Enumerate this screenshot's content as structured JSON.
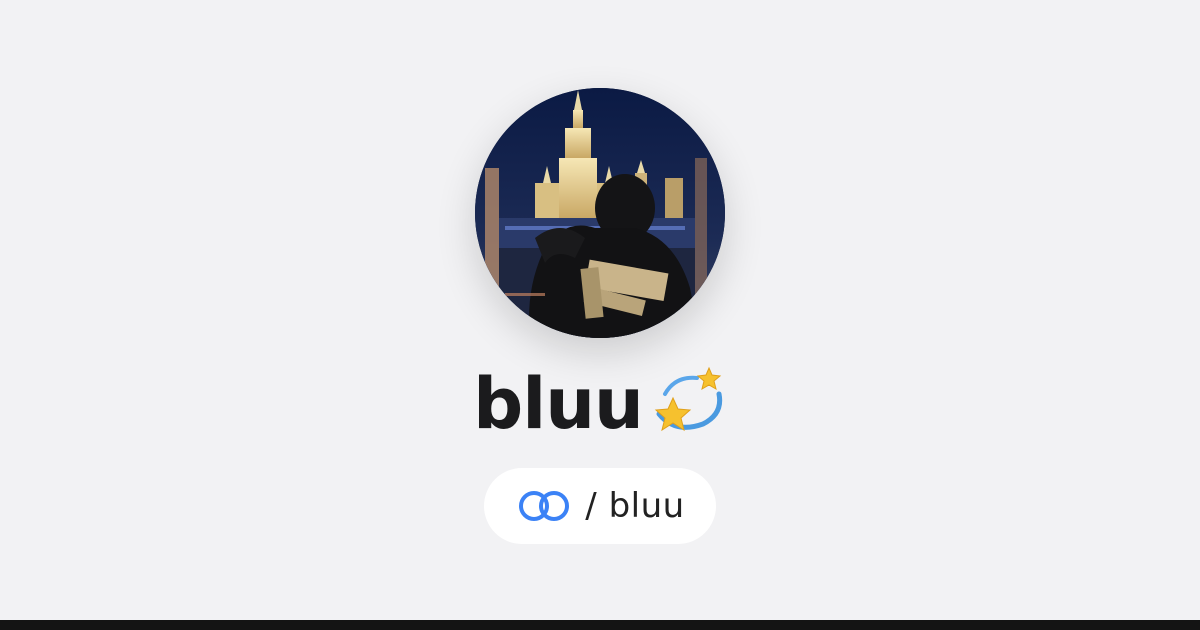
{
  "profile": {
    "display_name": "bluu",
    "name_badge_icon": "dizzy-star-icon",
    "avatar_description_icon": "profile-photo",
    "handle_prefix": "/ ",
    "handle": "bluu",
    "link_icon": "linked-rings-icon"
  },
  "colors": {
    "background": "#f2f2f4",
    "pill_background": "#ffffff",
    "link_icon": "#3b82f6",
    "bottom_bar": "#141414",
    "text": "#1b1b1d"
  }
}
